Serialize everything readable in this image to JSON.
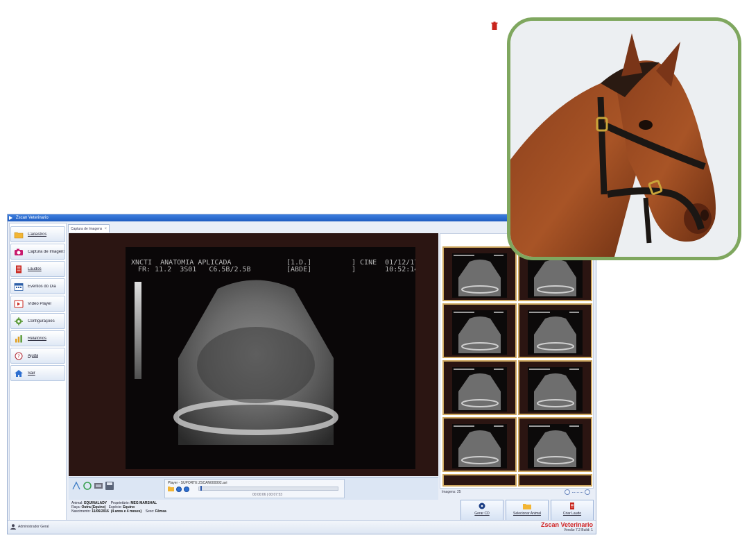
{
  "window": {
    "title": "Zscan Veterinario"
  },
  "sidebar": {
    "items": [
      {
        "label": "Cadastros",
        "icon": "folder-icon",
        "underline": true
      },
      {
        "label": "Captura de Imagens",
        "icon": "camera-icon",
        "underline": false
      },
      {
        "label": "Laudos",
        "icon": "report-icon",
        "underline": true
      },
      {
        "label": "Eventos do Dia",
        "icon": "calendar-icon",
        "underline": false
      },
      {
        "label": "Vídeo Player",
        "icon": "video-icon",
        "underline": false
      },
      {
        "label": "Configurações",
        "icon": "gear-icon",
        "underline": false
      },
      {
        "label": "Relatórios",
        "icon": "bar-chart-icon",
        "underline": true
      },
      {
        "label": "Ajuda",
        "icon": "help-icon",
        "underline": true
      },
      {
        "label": "Sair",
        "icon": "home-icon",
        "underline": true
      }
    ]
  },
  "tabs": [
    {
      "label": "Captura de Imagens"
    }
  ],
  "ultrasound": {
    "line1_left": "XNCTI  ANATOMIA APLICADA",
    "line2_left": "FR: 11.2  3S01   C6.5B/2.5B",
    "line1_mid": "[1.D.]",
    "line2_mid": "[ABDE]",
    "line1_right": "] CINE  01/12/17",
    "line2_right": "]       10:52:14"
  },
  "player": {
    "title": "Player - SUPORTE ZSCAN000002.avi",
    "time": "00:00:06 | 00:07:53",
    "progress": 0.01
  },
  "gallery": {
    "count_label": "Imagens: 25",
    "visible_thumbnails": 8
  },
  "animal_info": {
    "animal_label": "Animal:",
    "animal": "EQUINALADY",
    "owner_label": "Proprietário:",
    "owner": "MEG MARSHAL",
    "breed_label": "Raça:",
    "breed": "Outra (Equino)",
    "species_label": "Espécie:",
    "species": "Equino",
    "birth_label": "Nascimento:",
    "birth": "11/06/2016",
    "age": "(4 anos e 4 meses)",
    "sex_label": "Sexo:",
    "sex": "Fêmea"
  },
  "actions": [
    {
      "label": "Gerar CD",
      "icon": "cd-icon"
    },
    {
      "label": "Selecionar Animal",
      "icon": "folder-icon"
    },
    {
      "label": "Criar Laudo",
      "icon": "document-icon"
    }
  ],
  "status": {
    "user": "Administrador Geral",
    "brand": "Zscan Veterinario",
    "version": "Versão 7.2   Build: 1"
  },
  "colors": {
    "accent": "#1f5cc0",
    "brand_red": "#d12222",
    "thumb_border": "#cfa860",
    "card_border": "#7fa75f"
  }
}
